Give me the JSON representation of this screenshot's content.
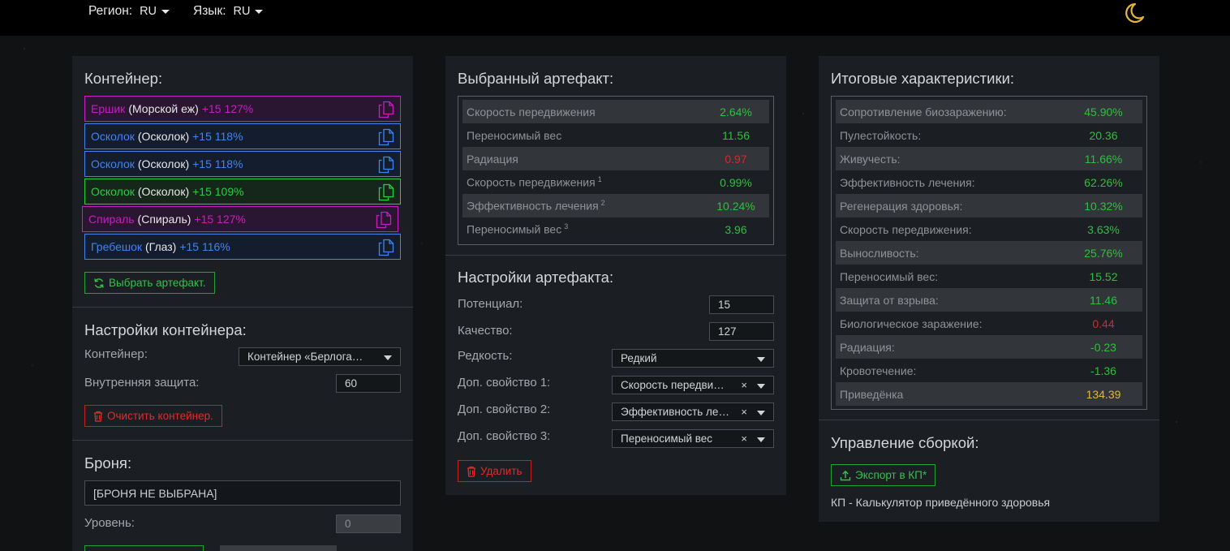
{
  "topbar": {
    "region_label": "Регион:",
    "region_value": "RU",
    "lang_label": "Язык:",
    "lang_value": "RU"
  },
  "container_panel": {
    "title": "Контейнер:",
    "items": [
      {
        "name": "Ершик",
        "type": "(Морской еж)",
        "level": "+15 127%",
        "color": "#c41fc0",
        "bg": "#2a1630"
      },
      {
        "name": "Осколок",
        "type": "(Осколок)",
        "level": "+15 118%",
        "color": "#3f84f0",
        "bg": "#141d2e"
      },
      {
        "name": "Осколок",
        "type": "(Осколок)",
        "level": "+15 118%",
        "color": "#3f84f0",
        "bg": "#141d2e"
      },
      {
        "name": "Осколок",
        "type": "(Осколок)",
        "level": "+15 109%",
        "color": "#27d13c",
        "bg": "#15261b"
      },
      {
        "name": "Спираль",
        "type": "(Спираль)",
        "level": "+15 127%",
        "color": "#c41fc0",
        "bg": "#2a1630"
      },
      {
        "name": "Гребешок",
        "type": "(Глаз)",
        "level": "+15 116%",
        "color": "#3f84f0",
        "bg": "#141d2e"
      }
    ],
    "choose_button": "Выбрать артефакт.",
    "settings_title": "Настройки контейнера:",
    "container_label": "Контейнер:",
    "container_value": "Контейнер «Берлога…",
    "protection_label": "Внутренняя защита:",
    "protection_value": "60",
    "clear_button": "Очистить контейнер.",
    "armor_title": "Броня:",
    "armor_value": "[БРОНЯ НЕ ВЫБРАНА]",
    "level_label": "Уровень:",
    "level_value": "0"
  },
  "artifact_panel": {
    "title": "Выбранный артефакт:",
    "rows": [
      {
        "k": "Скорость передвижения",
        "sup": "",
        "v": "2.64%",
        "color": "#2fbf3f"
      },
      {
        "k": "Переносимый вес",
        "sup": "",
        "v": "11.56",
        "color": "#2fbf3f"
      },
      {
        "k": "Радиация",
        "sup": "",
        "v": "0.97",
        "color": "#d62a2a"
      },
      {
        "k": "Скорость передвижения",
        "sup": "1",
        "v": "0.99%",
        "color": "#2fbf3f"
      },
      {
        "k": "Эффективность лечения",
        "sup": "2",
        "v": "10.24%",
        "color": "#2fbf3f"
      },
      {
        "k": "Переносимый вес",
        "sup": "3",
        "v": "3.96",
        "color": "#2fbf3f"
      }
    ],
    "settings_title": "Настройки артефакта:",
    "potential_label": "Потенциал:",
    "potential_value": "15",
    "quality_label": "Качество:",
    "quality_value": "127",
    "rarity_label": "Редкость:",
    "rarity_value": "Редкий",
    "prop1_label": "Доп. свойство 1:",
    "prop1_value": "Скорость передви…",
    "prop2_label": "Доп. свойство 2:",
    "prop2_value": "Эффективность ле…",
    "prop3_label": "Доп. свойство 3:",
    "prop3_value": "Переносимый вес",
    "clear_symbol": "×",
    "delete_button": "Удалить"
  },
  "stats_panel": {
    "title": "Итоговые характеристики:",
    "rows": [
      {
        "k": "Сопротивление биозаражению:",
        "v": "45.90%",
        "color": "#2fbf3f"
      },
      {
        "k": "Пулестойкость:",
        "v": "20.36",
        "color": "#2fbf3f"
      },
      {
        "k": "Живучесть:",
        "v": "11.66%",
        "color": "#2fbf3f"
      },
      {
        "k": "Эффективность лечения:",
        "v": "62.26%",
        "color": "#2fbf3f"
      },
      {
        "k": "Регенерация здоровья:",
        "v": "10.32%",
        "color": "#2fbf3f"
      },
      {
        "k": "Скорость передвижения:",
        "v": "3.63%",
        "color": "#2fbf3f"
      },
      {
        "k": "Выносливость:",
        "v": "25.76%",
        "color": "#2fbf3f"
      },
      {
        "k": "Переносимый вес:",
        "v": "15.52",
        "color": "#2fbf3f"
      },
      {
        "k": "Защита от взрыва:",
        "v": "11.46",
        "color": "#2fbf3f"
      },
      {
        "k": "Биологическое заражение:",
        "v": "0.44",
        "color": "#d62a2a"
      },
      {
        "k": "Радиация:",
        "v": "-0.23",
        "color": "#2fbf3f"
      },
      {
        "k": "Кровотечение:",
        "v": "-1.36",
        "color": "#2fbf3f"
      },
      {
        "k": "Приведёнка",
        "v": "134.39",
        "color": "#e8b43a"
      }
    ],
    "build_title": "Управление сборкой:",
    "export_button": "Экспорт в КП*",
    "footnote": "КП - Калькулятор приведённого здоровья"
  }
}
